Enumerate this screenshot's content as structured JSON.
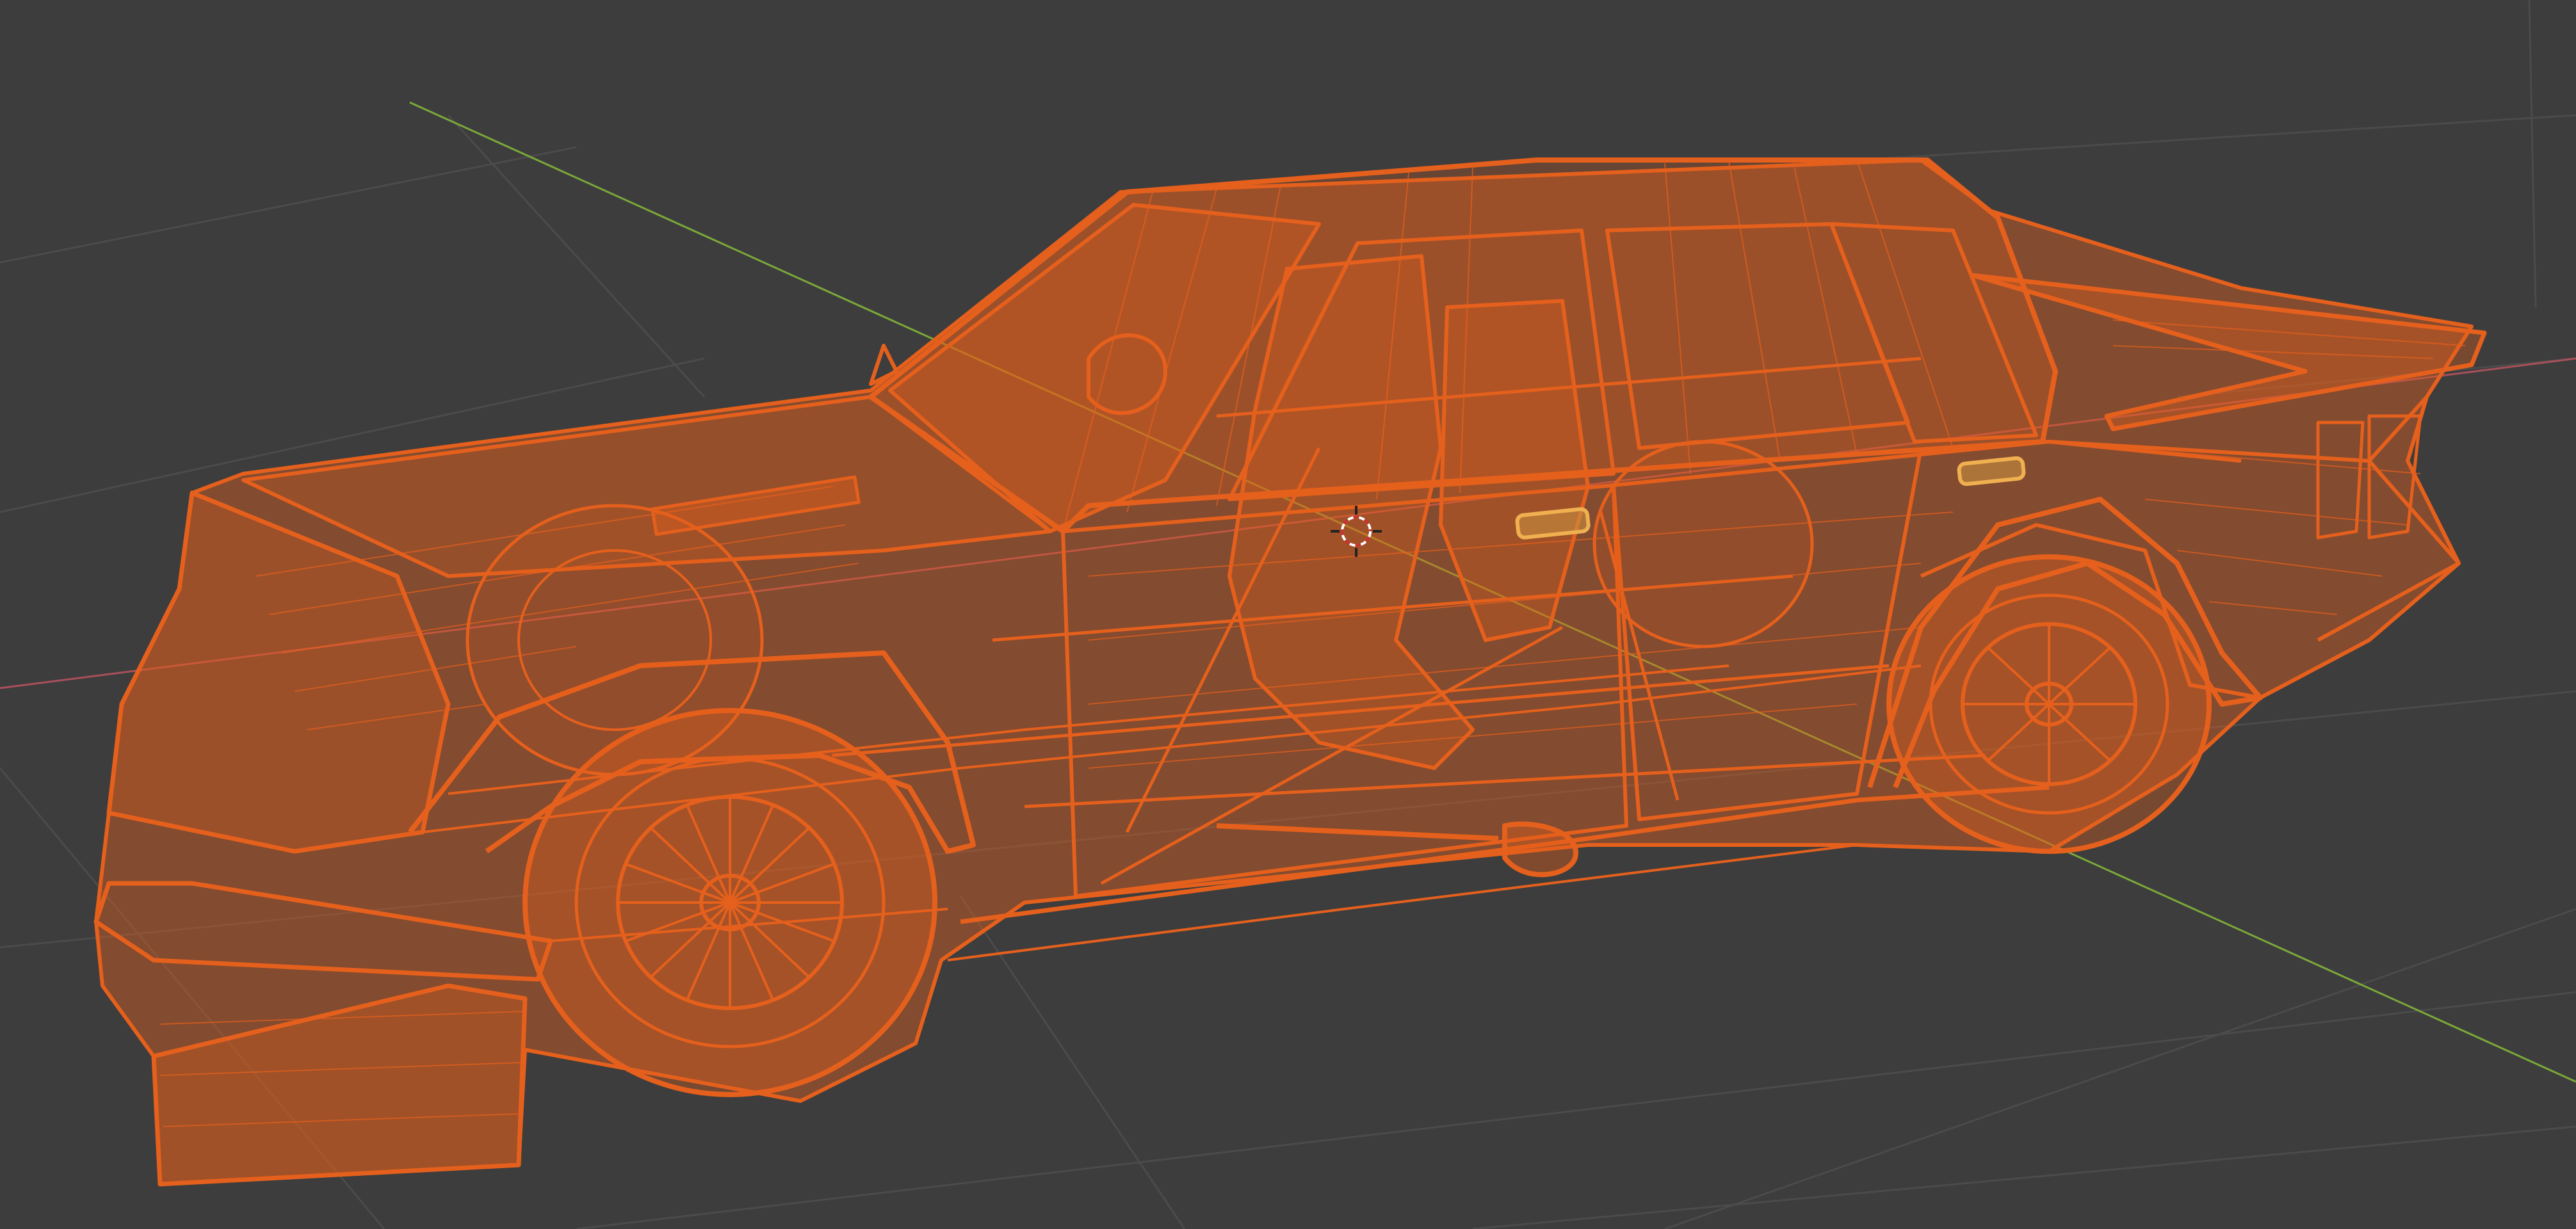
{
  "app": {
    "view": "3d-viewport",
    "shading_mode": "wireframe",
    "background_color": "#3d3d3d"
  },
  "scene": {
    "selected_object_color": "#e5601c",
    "active_highlight_color": "#f0b050",
    "grid_color": "#4a4a4a",
    "axis_x_color": "#a8505a",
    "axis_y_color": "#7ba83a",
    "object": {
      "name": "",
      "type": "car-wireframe-mesh",
      "selected": true
    },
    "cursor_icon": "3d-cursor-icon"
  }
}
